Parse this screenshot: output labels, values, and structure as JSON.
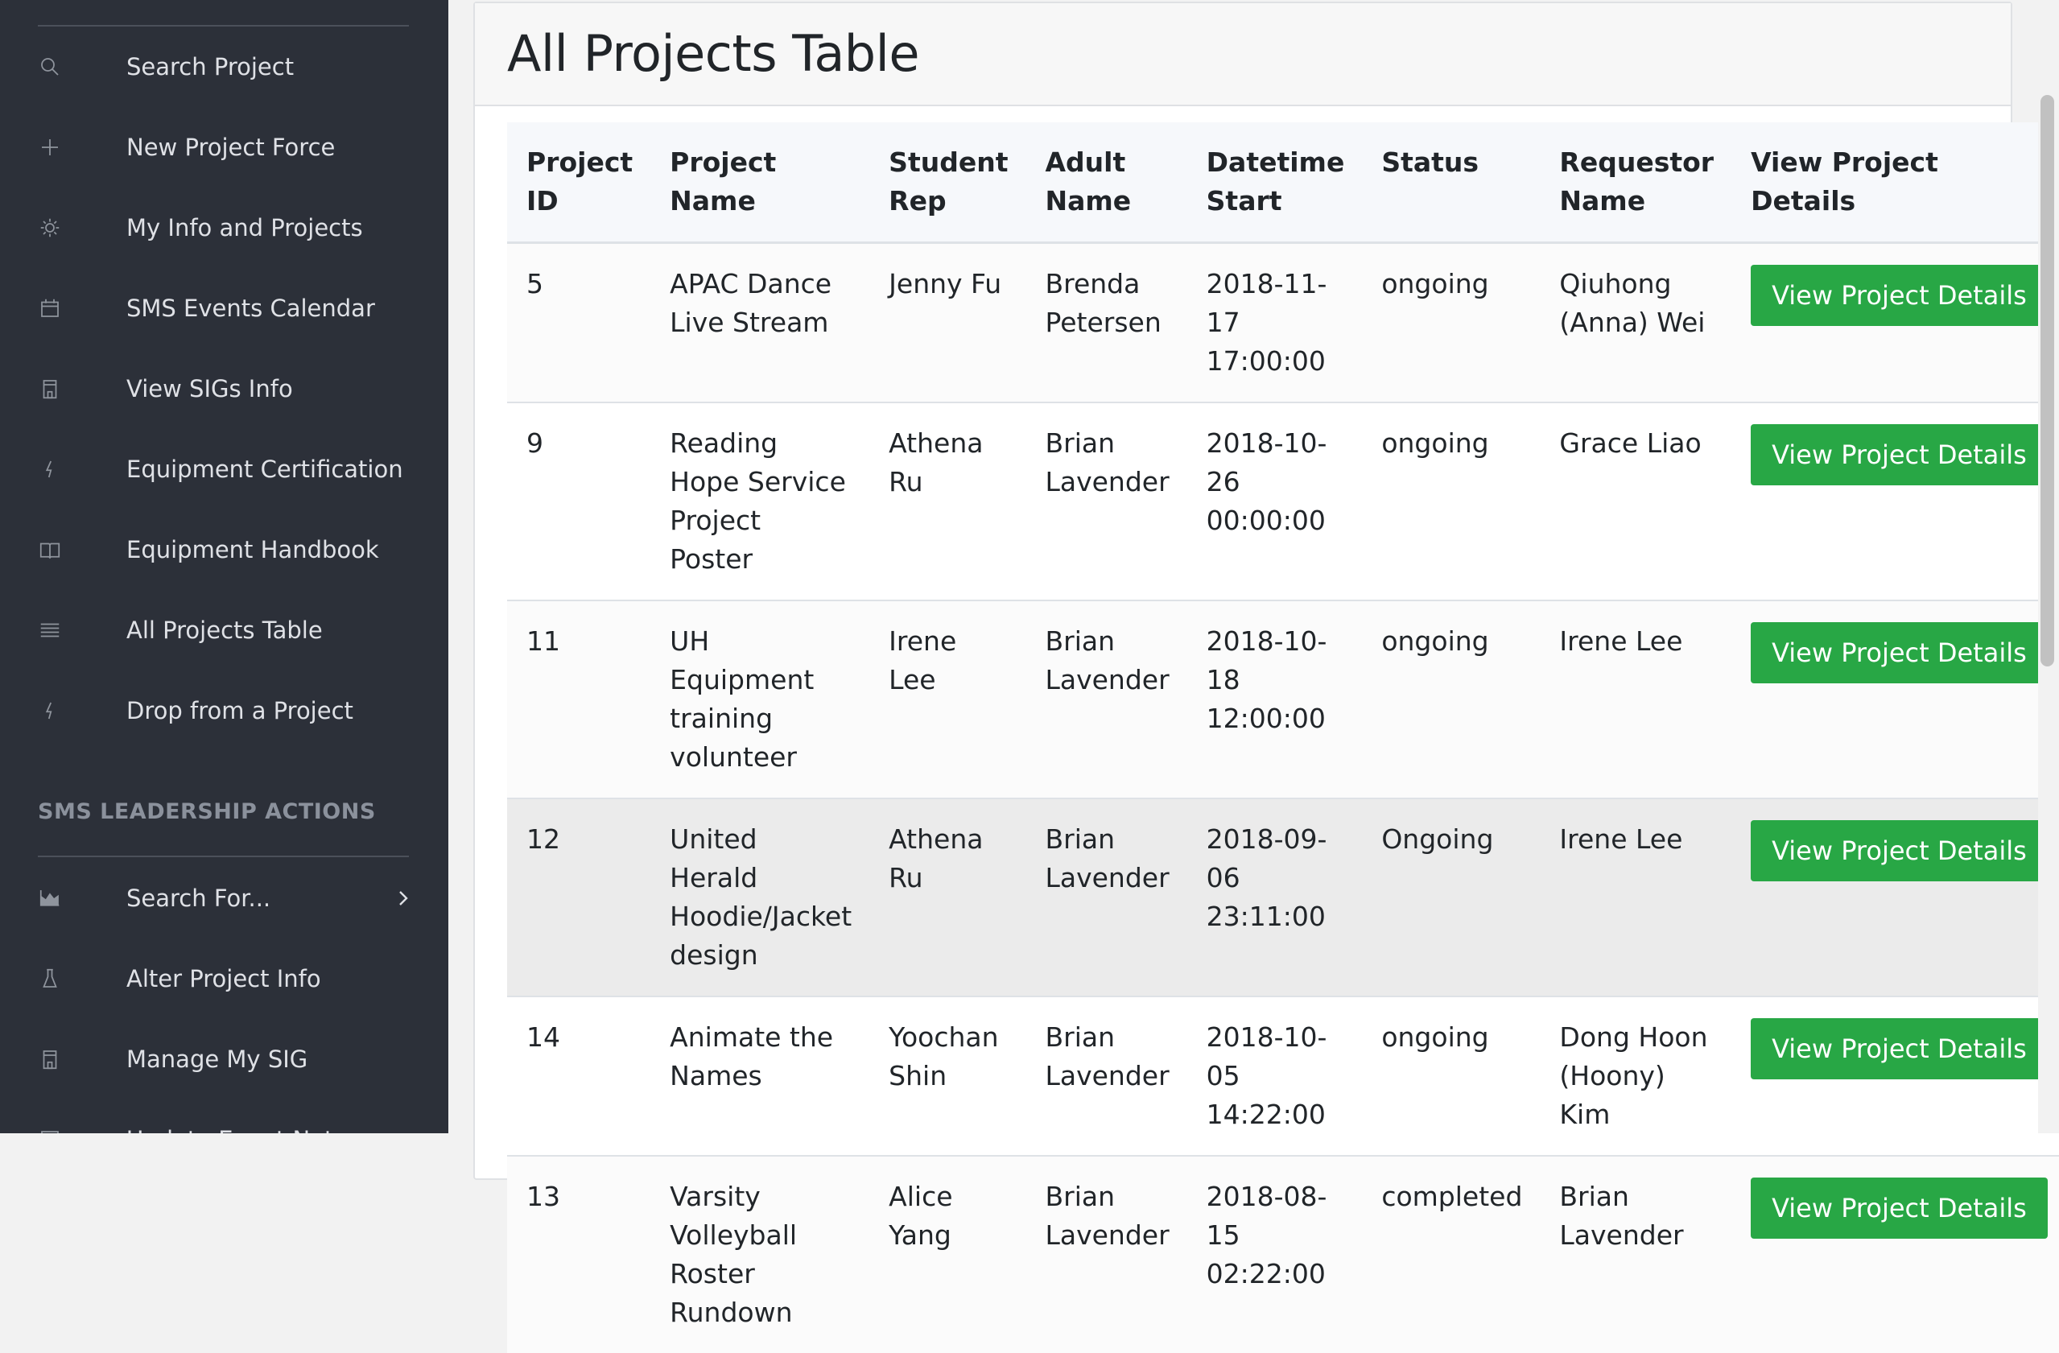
{
  "sidebar": {
    "items": [
      {
        "label": "Search Project",
        "icon": "search-icon"
      },
      {
        "label": "New Project Force",
        "icon": "plus-icon"
      },
      {
        "label": "My Info and Projects",
        "icon": "sun-icon"
      },
      {
        "label": "SMS Events Calendar",
        "icon": "calendar-icon"
      },
      {
        "label": "View SIGs Info",
        "icon": "building-icon"
      },
      {
        "label": "Equipment Certification",
        "icon": "bolt-icon"
      },
      {
        "label": "Equipment Handbook",
        "icon": "book-icon"
      },
      {
        "label": "All Projects Table",
        "icon": "list-icon"
      },
      {
        "label": "Drop from a Project",
        "icon": "bolt-icon"
      }
    ],
    "section_title": "SMS LEADERSHIP ACTIONS",
    "leadership_items": [
      {
        "label": "Search For...",
        "icon": "area-chart-icon",
        "has_submenu": true
      },
      {
        "label": "Alter Project Info",
        "icon": "flask-icon"
      },
      {
        "label": "Manage My SIG",
        "icon": "building-icon"
      },
      {
        "label": "Update Event Notes",
        "icon": "note-icon"
      }
    ]
  },
  "main": {
    "title": "All Projects Table",
    "table": {
      "headers": [
        "Project ID",
        "Project Name",
        "Student Rep",
        "Adult Name",
        "Datetime Start",
        "Status",
        "Requestor Name",
        "View Project Details"
      ],
      "rows": [
        {
          "id": "5",
          "name": "APAC Dance Live Stream",
          "rep": "Jenny Fu",
          "adult": "Brenda Petersen",
          "datetime": "2018-11-17 17:00:00",
          "status": "ongoing",
          "requestor": "Qiuhong (Anna) Wei",
          "button": "View Project Details"
        },
        {
          "id": "9",
          "name": "Reading Hope Service Project Poster",
          "rep": "Athena Ru",
          "adult": "Brian Lavender",
          "datetime": "2018-10-26 00:00:00",
          "status": "ongoing",
          "requestor": "Grace Liao",
          "button": "View Project Details"
        },
        {
          "id": "11",
          "name": "UH Equipment training volunteer",
          "rep": "Irene Lee",
          "adult": "Brian Lavender",
          "datetime": "2018-10-18 12:00:00",
          "status": "ongoing",
          "requestor": "Irene Lee",
          "button": "View Project Details"
        },
        {
          "id": "12",
          "name": "United Herald Hoodie/Jacket design",
          "rep": "Athena Ru",
          "adult": "Brian Lavender",
          "datetime": "2018-09-06 23:11:00",
          "status": "Ongoing",
          "requestor": "Irene Lee",
          "button": "View Project Details"
        },
        {
          "id": "14",
          "name": "Animate the Names",
          "rep": "Yoochan Shin",
          "adult": "Brian Lavender",
          "datetime": "2018-10-05 14:22:00",
          "status": "ongoing",
          "requestor": "Dong Hoon (Hoony) Kim",
          "button": "View Project Details"
        },
        {
          "id": "13",
          "name": "Varsity Volleyball Roster Rundown",
          "rep": "Alice Yang",
          "adult": "Brian Lavender",
          "datetime": "2018-08-15 02:22:00",
          "status": "completed",
          "requestor": "Brian Lavender",
          "button": "View Project Details"
        }
      ]
    }
  },
  "colors": {
    "sidebar_bg": "#2c3039",
    "sidebar_text": "#dfe1e6",
    "button_green": "#28a745",
    "highlight_row": "#ebebeb"
  }
}
